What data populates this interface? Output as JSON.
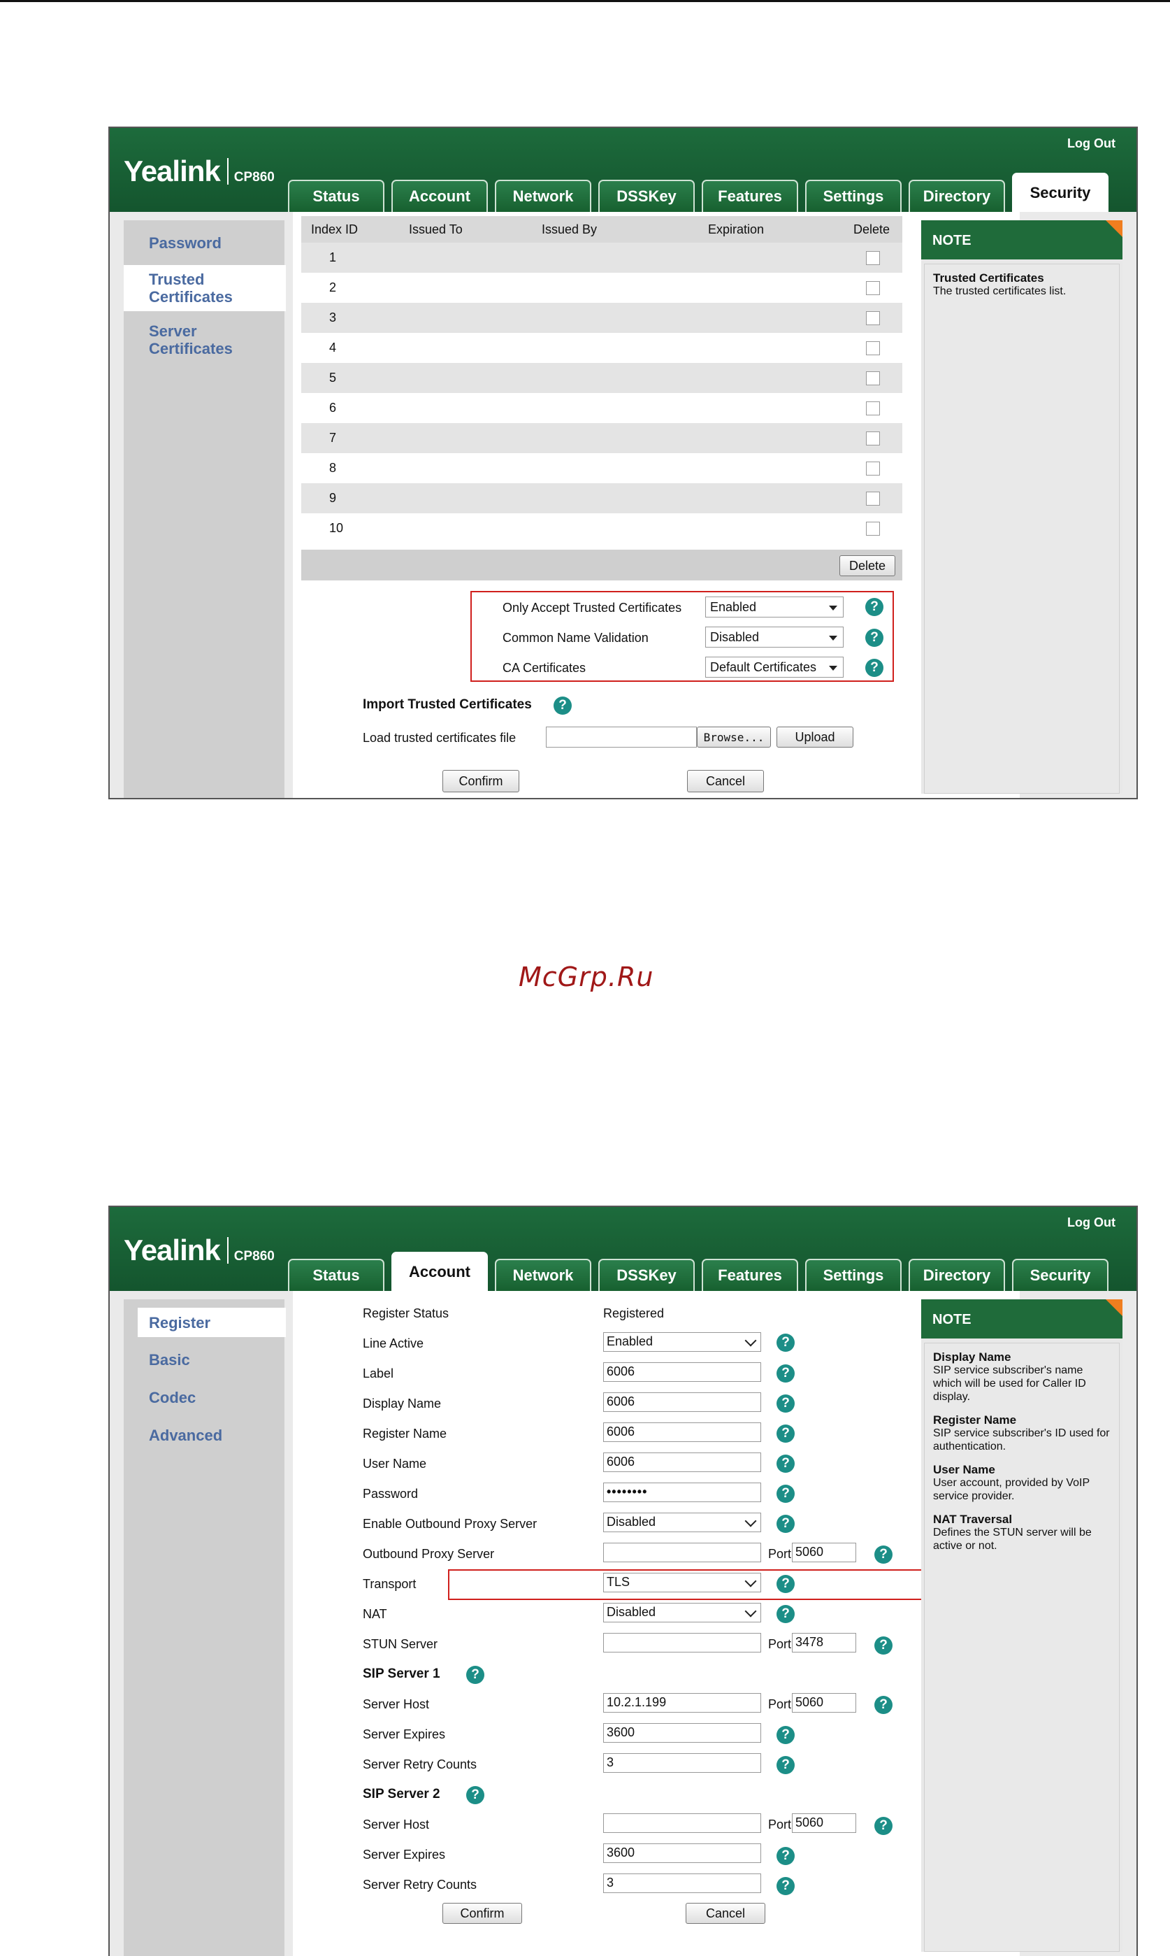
{
  "header": {
    "logo": "Yealink",
    "model": "CP860",
    "logout": "Log Out"
  },
  "tabs": [
    "Status",
    "Account",
    "Network",
    "DSSKey",
    "Features",
    "Settings",
    "Directory",
    "Security"
  ],
  "shot1": {
    "active_tab": "Security",
    "sidebar": [
      "Password",
      "Trusted Certificates",
      "Server Certificates"
    ],
    "active_side": "Trusted Certificates",
    "table": {
      "columns": [
        "Index ID",
        "Issued To",
        "Issued By",
        "Expiration",
        "Delete"
      ],
      "rows": [
        "1",
        "2",
        "3",
        "4",
        "5",
        "6",
        "7",
        "8",
        "9",
        "10"
      ]
    },
    "delete_button": "Delete",
    "options": [
      {
        "label": "Only Accept Trusted Certificates",
        "value": "Enabled"
      },
      {
        "label": "Common Name Validation",
        "value": "Disabled"
      },
      {
        "label": "CA Certificates",
        "value": "Default Certificates"
      }
    ],
    "import": {
      "title": "Import Trusted Certificates",
      "load_label": "Load trusted certificates file",
      "browse": "Browse...",
      "upload": "Upload"
    },
    "confirm": "Confirm",
    "cancel": "Cancel",
    "note": {
      "title": "NOTE",
      "items": [
        {
          "title": "Trusted Certificates",
          "text": "The trusted certificates list."
        }
      ]
    }
  },
  "watermark": "McGrp.Ru",
  "shot2": {
    "active_tab": "Account",
    "sidebar": [
      "Register",
      "Basic",
      "Codec",
      "Advanced"
    ],
    "active_side": "Register",
    "register_status": {
      "label": "Register Status",
      "value": "Registered"
    },
    "fields": {
      "line_active": {
        "label": "Line Active",
        "value": "Enabled"
      },
      "label": {
        "label": "Label",
        "value": "6006"
      },
      "display_name": {
        "label": "Display Name",
        "value": "6006"
      },
      "register_name": {
        "label": "Register Name",
        "value": "6006"
      },
      "user_name": {
        "label": "User Name",
        "value": "6006"
      },
      "password": {
        "label": "Password",
        "value": "••••••••"
      },
      "outbound_enable": {
        "label": "Enable Outbound Proxy Server",
        "value": "Disabled"
      },
      "outbound_server": {
        "label": "Outbound Proxy Server",
        "value": "",
        "port_label": "Port",
        "port": "5060"
      },
      "transport": {
        "label": "Transport",
        "value": "TLS"
      },
      "nat": {
        "label": "NAT",
        "value": "Disabled"
      },
      "stun": {
        "label": "STUN Server",
        "value": "",
        "port_label": "Port",
        "port": "3478"
      }
    },
    "sip1": {
      "title": "SIP Server 1",
      "host_label": "Server Host",
      "host": "10.2.1.199",
      "port_label": "Port",
      "port": "5060",
      "expires_label": "Server Expires",
      "expires": "3600",
      "retry_label": "Server Retry Counts",
      "retry": "3"
    },
    "sip2": {
      "title": "SIP Server 2",
      "host_label": "Server Host",
      "host": "",
      "port_label": "Port",
      "port": "5060",
      "expires_label": "Server Expires",
      "expires": "3600",
      "retry_label": "Server Retry Counts",
      "retry": "3"
    },
    "confirm": "Confirm",
    "cancel": "Cancel",
    "note": {
      "title": "NOTE",
      "items": [
        {
          "title": "Display Name",
          "text": "SIP service subscriber's name which will be used for Caller ID display."
        },
        {
          "title": "Register Name",
          "text": "SIP service subscriber's ID used for authentication."
        },
        {
          "title": "User Name",
          "text": "User account, provided by VoIP service provider."
        },
        {
          "title": "NAT Traversal",
          "text": "Defines the STUN server will be active or not."
        }
      ]
    }
  }
}
